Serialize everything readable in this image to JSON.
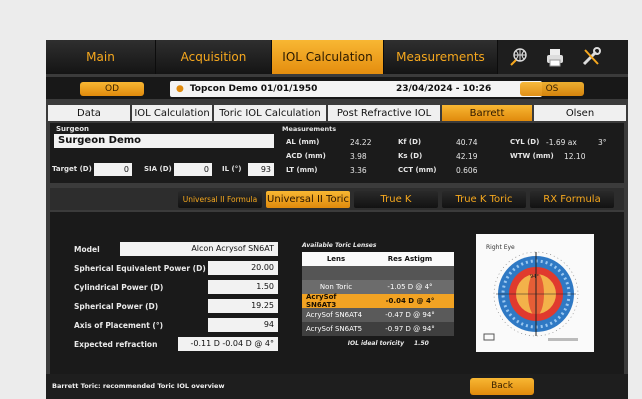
{
  "top_tabs": [
    {
      "label": "Main"
    },
    {
      "label": "Acquisition"
    },
    {
      "label": "IOL Calculation"
    },
    {
      "label": "Measurements"
    }
  ],
  "eye_left": "OD",
  "eye_right": "OS",
  "patient_name": "Topcon Demo 01/01/1950",
  "patient_date": "23/04/2024 - 10:26",
  "sub_tabs": [
    {
      "label": "Data"
    },
    {
      "label": "IOL Calculation"
    },
    {
      "label": "Toric IOL Calculation"
    },
    {
      "label": "Post Refractive IOL"
    },
    {
      "label": "Barrett"
    },
    {
      "label": "Olsen"
    }
  ],
  "surgeon": {
    "label": "Surgeon",
    "value": "Surgeon Demo"
  },
  "target": {
    "label": "Target (D)",
    "value": "0"
  },
  "sia": {
    "label": "SIA (D)",
    "value": "0"
  },
  "il": {
    "label": "IL (°)",
    "value": "93"
  },
  "measurements": {
    "label": "Measurements",
    "al_label": "AL (mm)",
    "al": "24.22",
    "acd_label": "ACD (mm)",
    "acd": "3.98",
    "lt_label": "LT (mm)",
    "lt": "3.36",
    "kf_label": "Kf (D)",
    "kf": "40.74",
    "ks_label": "Ks (D)",
    "ks": "42.19",
    "cct_label": "CCT (mm)",
    "cct": "0.606",
    "cyl_label": "CYL (D)",
    "cyl": "-1.69 ax",
    "cyl_axis": "3°",
    "wtw_label": "WTW (mm)",
    "wtw": "12.10"
  },
  "formula_tabs": [
    {
      "label": "Universal II Formula"
    },
    {
      "label": "Universal II Toric"
    },
    {
      "label": "True K"
    },
    {
      "label": "True K Toric"
    },
    {
      "label": "RX Formula"
    }
  ],
  "model": {
    "label": "Model",
    "value": "Alcon Acrysof SN6AT"
  },
  "spherical_equivalent": {
    "label": "Spherical Equivalent Power (D)",
    "value": "20.00"
  },
  "cylindrical_power": {
    "label": "Cylindrical Power (D)",
    "value": "1.50"
  },
  "spherical_power": {
    "label": "Spherical Power (D)",
    "value": "19.25"
  },
  "axis_placement": {
    "label": "Axis of Placement (°)",
    "value": "94"
  },
  "expected_refraction": {
    "label": "Expected refraction",
    "value": "-0.11 D -0.04 D @ 4°"
  },
  "lens_table": {
    "title": "Available Toric Lenses",
    "col_lens": "Lens",
    "col_res": "Res Astigm",
    "rows": [
      {
        "lens": "Non Toric",
        "res": "-1.05 D @ 4°"
      },
      {
        "lens": "AcrySof SN6AT3",
        "res": "-0.04 D @ 4°"
      },
      {
        "lens": "AcrySof SN6AT4",
        "res": "-0.47 D @ 94°"
      },
      {
        "lens": "AcrySof SN6AT5",
        "res": "-0.97 D @ 94°"
      }
    ],
    "ideal_label": "IOL ideal toricity",
    "ideal_value": "1.50"
  },
  "eye_diagram": {
    "label": "Right Eye",
    "axis_label": "94°"
  },
  "footer": {
    "caption": "Barrett Toric: recommended Toric IOL overview",
    "back_label": "Back"
  },
  "colors": {
    "accent": "#f6a81e",
    "background": "#3b3b3b",
    "panel": "#1a1a1a"
  }
}
